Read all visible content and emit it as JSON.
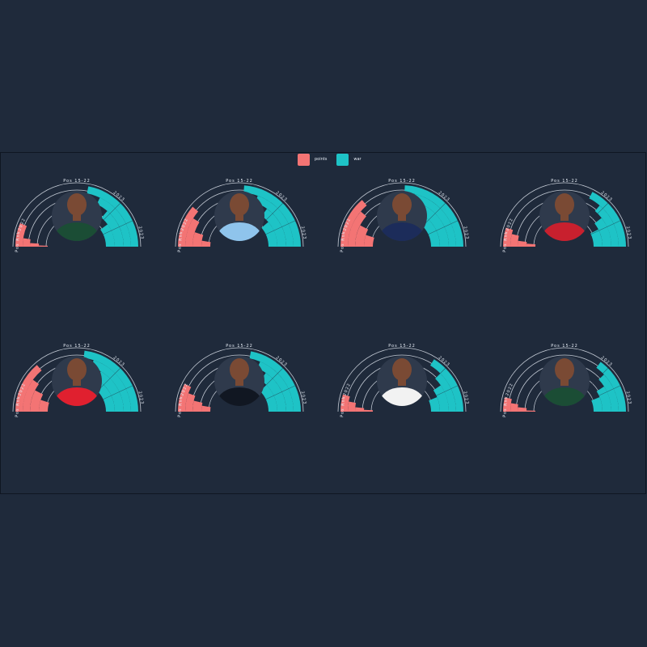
{
  "legend": [
    {
      "label": "points",
      "color": "#f37474"
    },
    {
      "label": "war",
      "color": "#1ec3c6"
    }
  ],
  "colors": {
    "background": "#1f2a3b",
    "ring": "#dfe5ee",
    "photo_bg": "#2f3a4c"
  },
  "chart_data": {
    "type": "radial-bar",
    "note_rings": [
      "Pos",
      "2022",
      "2023",
      "Pos Rnk"
    ],
    "legend": [
      "points",
      "war"
    ],
    "players": [
      {
        "label": "",
        "jersey": "#1b4d35",
        "ring_labels": {
          "left_top": "2022",
          "left_bottom": "Pos Rnk",
          "right_top": "Pos 15-22",
          "right_mid": "2023",
          "right_bottom": "2023"
        },
        "points": [
          0.25,
          0.1,
          0.05,
          0.02
        ],
        "war": [
          0.88,
          0.72,
          0.55,
          0.4
        ]
      },
      {
        "label": "",
        "jersey": "#8fc4ec",
        "ring_labels": {
          "left_top": "2022",
          "left_bottom": "Pos Rnk",
          "right_top": "Pos 15-22",
          "right_mid": "2023",
          "right_bottom": "2023"
        },
        "points": [
          0.45,
          0.35,
          0.2,
          0.1
        ],
        "war": [
          0.95,
          0.78,
          0.6,
          0.45
        ]
      },
      {
        "label": "",
        "jersey": "#1c2c5a",
        "ring_labels": {
          "left_top": "2022",
          "left_bottom": "Pos Rnk",
          "right_top": "Pos 15-22",
          "right_mid": "2023",
          "right_bottom": "2023"
        },
        "points": [
          0.55,
          0.45,
          0.3,
          0.2
        ],
        "war": [
          0.97,
          0.85,
          0.7,
          0.55
        ]
      },
      {
        "label": "",
        "jersey": "#c8202e",
        "ring_labels": {
          "left_top": "2022",
          "left_bottom": "Pos Rnk",
          "right_top": "Pos 15-22",
          "right_mid": "2023",
          "right_bottom": "2023"
        },
        "points": [
          0.2,
          0.15,
          0.08,
          0.05
        ],
        "war": [
          0.7,
          0.55,
          0.42,
          0.3
        ]
      },
      {
        "label": "",
        "jersey": "#e0202f",
        "ring_labels": {
          "left_top": "2022",
          "left_bottom": "Pos Rnk",
          "right_top": "Pos 15-22",
          "right_mid": "2023",
          "right_bottom": "2023"
        },
        "points": [
          0.55,
          0.4,
          0.3,
          0.2
        ],
        "war": [
          0.92,
          0.8,
          0.66,
          0.55
        ]
      },
      {
        "label": "",
        "jersey": "#111722",
        "ring_labels": {
          "left_top": "2022",
          "left_bottom": "Pos Rnk",
          "right_top": "Pos 15-22",
          "right_mid": "2023",
          "right_bottom": "2023"
        },
        "points": [
          0.3,
          0.22,
          0.15,
          0.1
        ],
        "war": [
          0.88,
          0.75,
          0.62,
          0.5
        ]
      },
      {
        "label": "",
        "jersey": "#f2f2f2",
        "ring_labels": {
          "left_top": "2022",
          "left_bottom": "Pos Rnk",
          "right_top": "Pos 15-22",
          "right_mid": "2023",
          "right_bottom": "2023"
        },
        "points": [
          0.18,
          0.12,
          0.06,
          0.03
        ],
        "war": [
          0.65,
          0.5,
          0.38,
          0.25
        ]
      },
      {
        "label": "",
        "jersey": "#1b4d35",
        "ring_labels": {
          "left_top": "2022",
          "left_bottom": "Pos Rnk",
          "right_top": "Pos 15-22",
          "right_mid": "2023",
          "right_bottom": "2023"
        },
        "points": [
          0.15,
          0.1,
          0.06,
          0.02
        ],
        "war": [
          0.6,
          0.48,
          0.36,
          0.25
        ]
      }
    ]
  }
}
